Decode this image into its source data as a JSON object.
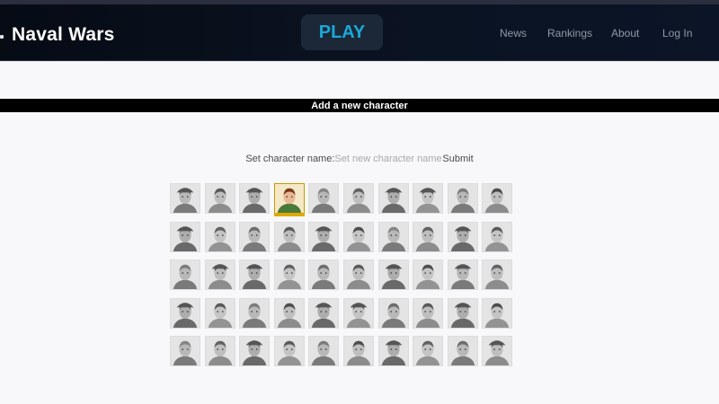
{
  "navbar": {
    "brand": "Naval Wars",
    "play_label": "PLAY",
    "links": [
      "News",
      "Rankings",
      "About",
      "Log In"
    ]
  },
  "section": {
    "title": "Add a new character"
  },
  "form": {
    "label": "Set character name:",
    "placeholder": "Set new character name...",
    "value": "",
    "submit_label": "Submit"
  },
  "portraits": {
    "rows": 5,
    "columns": 10,
    "count": 50,
    "selected_index": 3
  },
  "colors": {
    "navbar_bg": "#0a1220",
    "play_text": "#1aa8d8",
    "play_bg": "#1c2738",
    "selected_highlight": "#e0a800",
    "section_bar": "#000000"
  }
}
